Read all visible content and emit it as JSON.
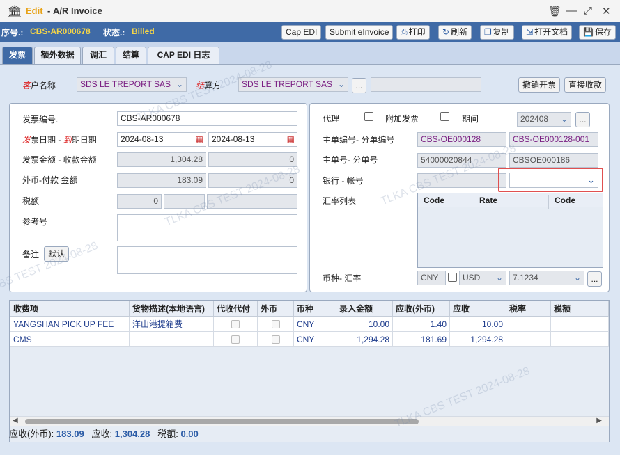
{
  "window": {
    "mode": "Edit",
    "separator": "-",
    "title": "A/R Invoice"
  },
  "toolbar": {
    "seq_label": "序号.:",
    "seq_value": "CBS-AR000678",
    "status_label": "状态.:",
    "status_value": "Billed",
    "cap_edi": "Cap EDI",
    "submit": "Submit eInvoice",
    "print": "打印",
    "refresh": "刷新",
    "copy": "复制",
    "open_doc": "打开文档",
    "save": "保存"
  },
  "tabs": [
    "发票",
    "额外数据",
    "调汇",
    "结算",
    "CAP EDI 日志"
  ],
  "customer": {
    "label_red": "客",
    "label": "户名称",
    "value": "SDS LE TREPORT SAS"
  },
  "settle": {
    "label_red": "结",
    "label": "算方",
    "value": "SDS LE TREPORT SAS",
    "more": "..."
  },
  "actions": {
    "cancel_invoice": "撤销开票",
    "direct_collect": "直接收款"
  },
  "left": {
    "invoice_no_label": "发票编号.",
    "invoice_no": "CBS-AR000678",
    "date_red1": "发",
    "date_label1": "票日期 -",
    "date_red2": "到",
    "date_label2": "期日期",
    "invoice_date": "2024-08-13",
    "due_date": "2024-08-13",
    "amount_label": "发票金额 - 收款金额",
    "amount": "1,304.28",
    "received": "0",
    "fx_label": "外币-付款 金额",
    "fx_amount": "183.09",
    "fx_paid": "0",
    "tax_label": "税额",
    "tax": "0",
    "tax2": "",
    "tax3": "",
    "ref_label": "参考号",
    "ref_value": "",
    "remark_label": "备注",
    "remark_default": "默认",
    "remark_value": ""
  },
  "right": {
    "agent_label": "代理",
    "extra_invoice_label": "附加发票",
    "period_label": "期间",
    "period_value": "202408",
    "more": "...",
    "master_label": "主单编号- 分单编号",
    "master_no": "CBS-OE000128",
    "sub_no": "CBS-OE000128-001",
    "mbl_label": "主单号- 分单号",
    "mbl": "54000020844",
    "hbl": "CBSOE000186",
    "bank_label": "银行 - 帐号",
    "bank": "",
    "account": "",
    "rate_list_label": "汇率列表",
    "rate_cols": [
      "Code",
      "Rate",
      "Code"
    ],
    "currency_label": "币种- 汇率",
    "currency": "CNY",
    "fx_currency": "USD",
    "fx_rate": "7.1234"
  },
  "grid": {
    "headers": [
      "收费项",
      "货物描述(本地语言)",
      "代收代付",
      "外币",
      "币种",
      "录入金额",
      "应收(外币)",
      "应收",
      "税率",
      "税额"
    ],
    "rows": [
      {
        "item": "YANGSHAN PICK UP FEE",
        "desc": "洋山港提箱费",
        "currency": "CNY",
        "amount": "10.00",
        "fx": "1.40",
        "ar": "10.00"
      },
      {
        "item": "CMS",
        "desc": "",
        "currency": "CNY",
        "amount": "1,294.28",
        "fx": "181.69",
        "ar": "1,294.28"
      }
    ]
  },
  "footer": {
    "fx_label": "应收(外币):",
    "fx_value": "183.09",
    "ar_label": "应收:",
    "ar_value": "1,304.28",
    "tax_label": "税额:",
    "tax_value": "0.00"
  },
  "watermark": "TLKA CBS TEST 2024-08-28"
}
